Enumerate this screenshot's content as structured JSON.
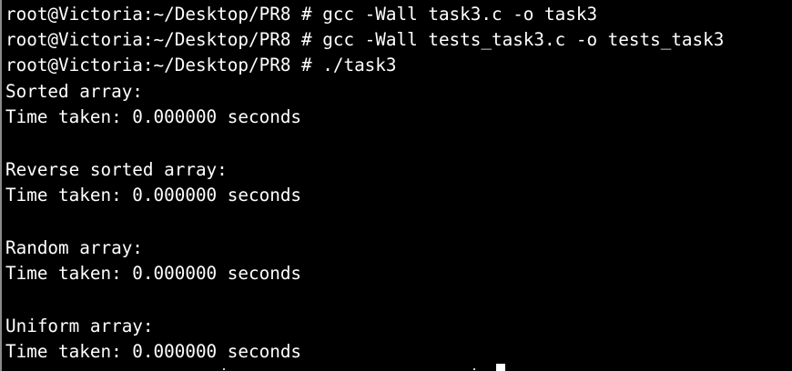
{
  "terminal": {
    "lines": [
      "root@Victoria:~/Desktop/PR8 # gcc -Wall task3.c -o task3",
      "root@Victoria:~/Desktop/PR8 # gcc -Wall tests_task3.c -o tests_task3",
      "root@Victoria:~/Desktop/PR8 # ./task3",
      "Sorted array:",
      "Time taken: 0.000000 seconds",
      "",
      "Reverse sorted array:",
      "Time taken: 0.000000 seconds",
      "",
      "Random array:",
      "Time taken: 0.000000 seconds",
      "",
      "Uniform array:",
      "Time taken: 0.000000 seconds"
    ]
  }
}
